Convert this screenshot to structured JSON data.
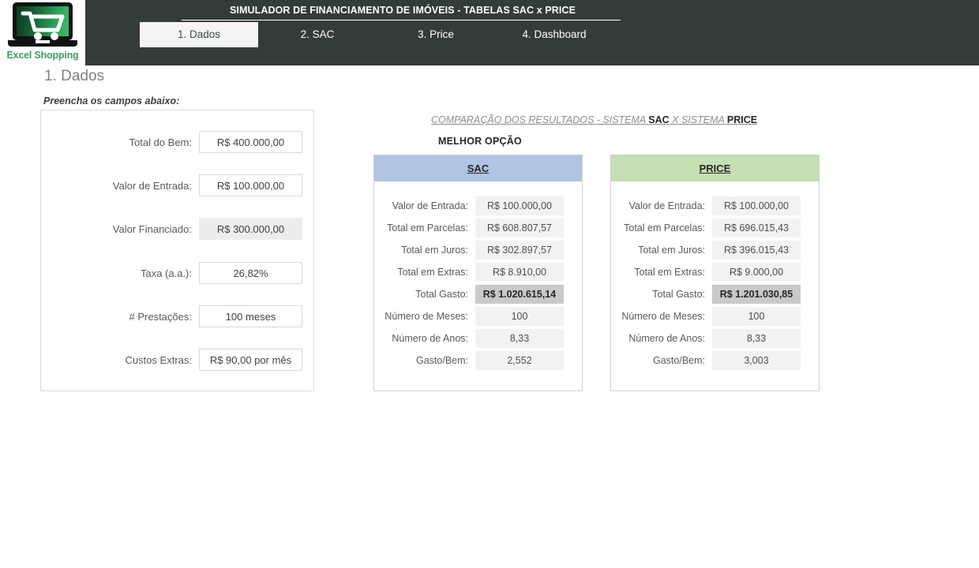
{
  "brand": {
    "logo_text": "Excel Shopping",
    "logo_icon": "laptop-shopping-cart-icon"
  },
  "header": {
    "title": "SIMULADOR DE FINANCIAMENTO DE IMÓVEIS - TABELAS SAC x PRICE",
    "background_color": "#333c37",
    "tabs": [
      {
        "label": "1. Dados",
        "active": true
      },
      {
        "label": "2. SAC",
        "active": false
      },
      {
        "label": "3. Price",
        "active": false
      },
      {
        "label": "4. Dashboard",
        "active": false
      }
    ]
  },
  "page": {
    "title": "1. Dados",
    "fill_hint": "Preencha os campos abaixo:"
  },
  "form": {
    "fields": [
      {
        "label": "Total do Bem:",
        "value": "R$ 400.000,00",
        "readonly": false
      },
      {
        "label": "Valor de Entrada:",
        "value": "R$ 100.000,00",
        "readonly": false
      },
      {
        "label": "Valor Financiado:",
        "value": "R$ 300.000,00",
        "readonly": true
      },
      {
        "label": "Taxa (a.a.):",
        "value": "26,82%",
        "readonly": false
      },
      {
        "label": "# Prestações:",
        "value": "100 meses",
        "readonly": false
      },
      {
        "label": "Custos Extras:",
        "value": "R$ 90,00 por mês",
        "readonly": false
      }
    ]
  },
  "comparison": {
    "title_prefix": "COMPARAÇÃO DOS RESULTADOS - SISTEMA ",
    "title_sac": "SAC",
    "title_middle": " X SISTEMA ",
    "title_price": "PRICE",
    "best_option_label": "MELHOR OPÇÃO",
    "sac": {
      "header": "SAC",
      "header_color": "#b0c4e4",
      "rows": [
        {
          "label": "Valor de Entrada:",
          "value": "R$ 100.000,00",
          "highlight": false
        },
        {
          "label": "Total em Parcelas:",
          "value": "R$ 608.807,57",
          "highlight": false
        },
        {
          "label": "Total em Juros:",
          "value": "R$ 302.897,57",
          "highlight": false
        },
        {
          "label": "Total em Extras:",
          "value": "R$ 8.910,00",
          "highlight": false
        },
        {
          "label": "Total Gasto:",
          "value": "R$ 1.020.615,14",
          "highlight": true
        },
        {
          "label": "Número de Meses:",
          "value": "100",
          "highlight": false
        },
        {
          "label": "Número de Anos:",
          "value": "8,33",
          "highlight": false
        },
        {
          "label": "Gasto/Bem:",
          "value": "2,552",
          "highlight": false
        }
      ]
    },
    "price": {
      "header": "PRICE",
      "header_color": "#c5e0b3",
      "rows": [
        {
          "label": "Valor de Entrada:",
          "value": "R$ 100.000,00",
          "highlight": false
        },
        {
          "label": "Total em Parcelas:",
          "value": "R$ 696.015,43",
          "highlight": false
        },
        {
          "label": "Total em Juros:",
          "value": "R$ 396.015,43",
          "highlight": false
        },
        {
          "label": "Total em Extras:",
          "value": "R$ 9.000,00",
          "highlight": false
        },
        {
          "label": "Total Gasto:",
          "value": "R$ 1.201.030,85",
          "highlight": true
        },
        {
          "label": "Número de Meses:",
          "value": "100",
          "highlight": false
        },
        {
          "label": "Número de Anos:",
          "value": "8,33",
          "highlight": false
        },
        {
          "label": "Gasto/Bem:",
          "value": "3,003",
          "highlight": false
        }
      ]
    }
  }
}
